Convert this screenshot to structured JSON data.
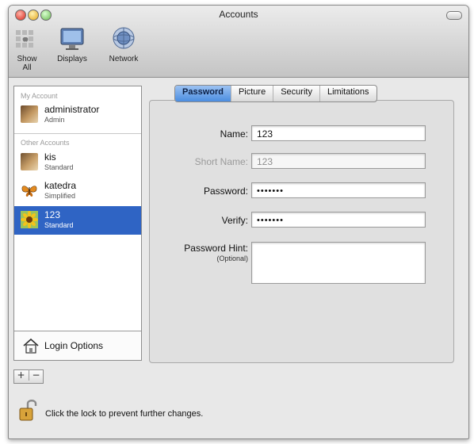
{
  "window": {
    "title": "Accounts"
  },
  "toolbar": {
    "items": [
      {
        "label": "Show All",
        "icon": "apple-grid-icon"
      },
      {
        "label": "Displays",
        "icon": "display-icon"
      },
      {
        "label": "Network",
        "icon": "network-globe-icon"
      }
    ]
  },
  "sidebar": {
    "my_account_label": "My Account",
    "other_accounts_label": "Other Accounts",
    "my_account": {
      "name": "administrator",
      "type": "Admin",
      "icon": "dog-photo-icon"
    },
    "accounts": [
      {
        "name": "kis",
        "type": "Standard",
        "icon": "dog-photo-icon"
      },
      {
        "name": "katedra",
        "type": "Simplified",
        "icon": "butterfly-icon"
      },
      {
        "name": "123",
        "type": "Standard",
        "icon": "sunflower-icon",
        "selected": true
      }
    ],
    "login_options": "Login Options",
    "add_button": "+",
    "remove_button": "−"
  },
  "tabs": [
    "Password",
    "Picture",
    "Security",
    "Limitations"
  ],
  "active_tab": "Password",
  "form": {
    "name_label": "Name:",
    "name_value": "123",
    "short_name_label": "Short Name:",
    "short_name_value": "123",
    "password_label": "Password:",
    "password_value": "•••••••",
    "verify_label": "Verify:",
    "verify_value": "•••••••",
    "hint_label": "Password Hint:",
    "hint_sub": "(Optional)",
    "hint_value": ""
  },
  "lock": {
    "text": "Click the lock to prevent further changes."
  },
  "colors": {
    "selection": "#2f64c4",
    "tab_active": "#4b8de0"
  }
}
